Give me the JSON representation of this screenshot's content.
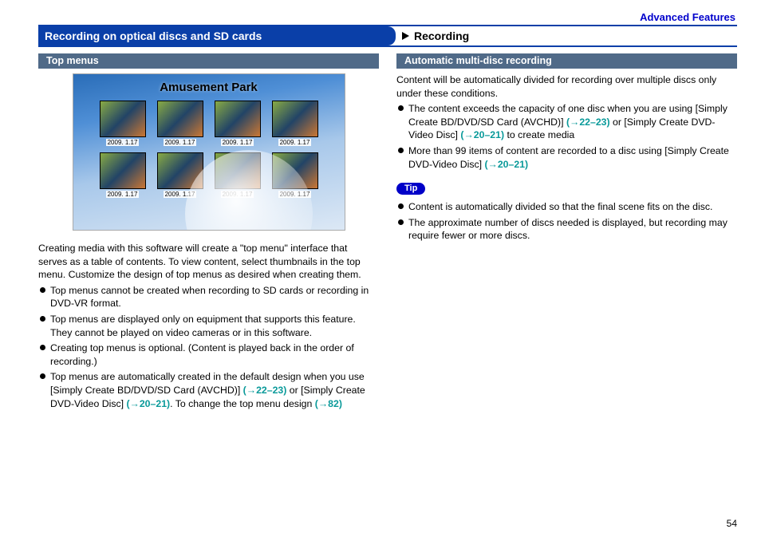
{
  "header_link": "Advanced Features",
  "title_left": "Recording on optical discs and SD cards",
  "title_right": "Recording",
  "page_number": "54",
  "left": {
    "subheader": "Top menus",
    "figure": {
      "title": "Amusement Park",
      "date_label": "2009. 1.17"
    },
    "intro": "Creating media with this software will create a \"top menu\" interface that serves as a table of contents. To view content, select thumbnails in the top menu. Customize the design of top menus as desired when creating them.",
    "b1": "Top menus cannot be created when recording to SD cards or recording in DVD-VR format.",
    "b2": "Top menus are displayed only on equipment that supports this feature. They cannot be played on video cameras or in this software.",
    "b3": "Creating top menus is optional. (Content is played back in the order of recording.)",
    "b4_a": "Top menus are automatically created in the default design when you use [Simply Create BD/DVD/SD Card (AVCHD)] ",
    "b4_ref1": "(→22–23)",
    "b4_b": " or [Simply Create DVD-Video Disc] ",
    "b4_ref2": "(→20–21)",
    "b4_c": ". To change the top menu design ",
    "b4_ref3": "(→82)"
  },
  "right": {
    "subheader": "Automatic multi-disc recording",
    "intro": "Content will be automatically divided for recording over multiple discs only under these conditions.",
    "b1_a": "The content exceeds the capacity of one disc when you are using [Simply Create BD/DVD/SD Card (AVCHD)] ",
    "b1_ref1": "(→22–23)",
    "b1_b": " or [Simply Create DVD-Video Disc] ",
    "b1_ref2": "(→20–21)",
    "b1_c": " to create media",
    "b2_a": "More than 99 items of content are recorded to a disc using [Simply Create DVD-Video Disc] ",
    "b2_ref1": "(→20–21)",
    "tip_label": "Tip",
    "tip_b1": "Content is automatically divided so that the final scene fits on the disc.",
    "tip_b2": "The approximate number of discs needed is displayed, but recording may require fewer or more discs."
  }
}
